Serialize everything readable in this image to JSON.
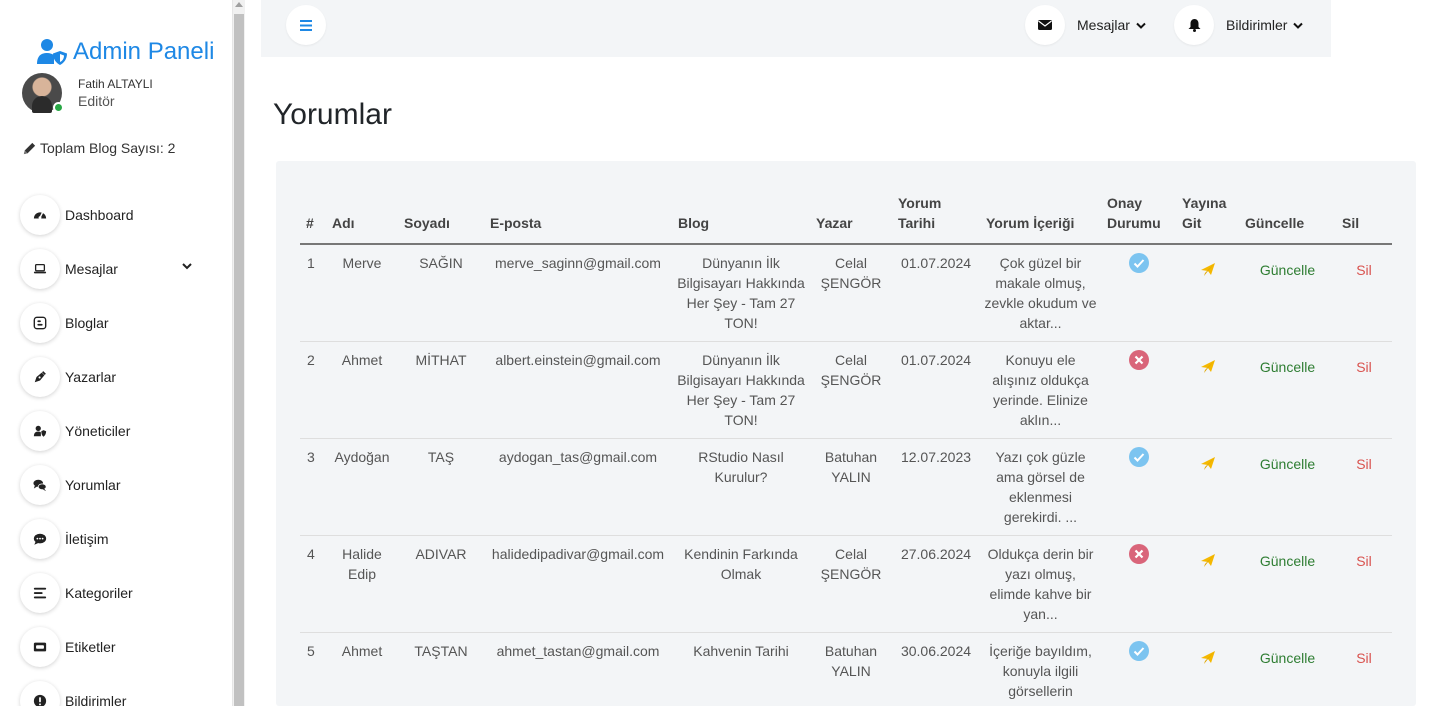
{
  "sidebar": {
    "brand": "Admin Paneli",
    "user_name": "Fatih ALTAYLI",
    "user_role": "Editör",
    "blog_count": "Toplam Blog Sayısı: 2",
    "items": [
      {
        "label": "Dashboard",
        "icon": "gauge-icon"
      },
      {
        "label": "Mesajlar",
        "icon": "laptop-icon"
      },
      {
        "label": "Bloglar",
        "icon": "blogger-icon"
      },
      {
        "label": "Yazarlar",
        "icon": "pen-icon"
      },
      {
        "label": "Yöneticiler",
        "icon": "user-shield-icon"
      },
      {
        "label": "Yorumlar",
        "icon": "comments-icon"
      },
      {
        "label": "İletişim",
        "icon": "comment-dots-icon"
      },
      {
        "label": "Kategoriler",
        "icon": "list-icon"
      },
      {
        "label": "Etiketler",
        "icon": "tag-icon"
      },
      {
        "label": "Bildirimler",
        "icon": "exclamation-icon"
      }
    ]
  },
  "topbar": {
    "messages": "Mesajlar",
    "notifications": "Bildirimler"
  },
  "page": {
    "title": "Yorumlar"
  },
  "table": {
    "headers": {
      "num": "#",
      "name": "Adı",
      "surname": "Soyadı",
      "email": "E-posta",
      "blog": "Blog",
      "author": "Yazar",
      "date": "Yorum Tarihi",
      "content": "Yorum İçeriği",
      "status": "Onay Durumu",
      "goto": "Yayına Git",
      "update": "Güncelle",
      "delete": "Sil"
    },
    "rows": [
      {
        "num": "1",
        "name": "Merve",
        "surname": "SAĞIN",
        "email": "merve_saginn@gmail.com",
        "blog": "Dünyanın İlk Bilgisayarı Hakkında Her Şey - Tam 27 TON!",
        "author": "Celal ŞENGÖR",
        "date": "01.07.2024",
        "content": "Çok güzel bir makale olmuş, zevkle okudum ve aktar...",
        "approved": true,
        "update": "Güncelle",
        "delete": "Sil"
      },
      {
        "num": "2",
        "name": "Ahmet",
        "surname": "MİTHAT",
        "email": "albert.einstein@gmail.com",
        "blog": "Dünyanın İlk Bilgisayarı Hakkında Her Şey - Tam 27 TON!",
        "author": "Celal ŞENGÖR",
        "date": "01.07.2024",
        "content": "Konuyu ele alışınız oldukça yerinde. Elinize aklın...",
        "approved": false,
        "update": "Güncelle",
        "delete": "Sil"
      },
      {
        "num": "3",
        "name": "Aydoğan",
        "surname": "TAŞ",
        "email": "aydogan_tas@gmail.com",
        "blog": "RStudio Nasıl Kurulur?",
        "author": "Batuhan YALIN",
        "date": "12.07.2023",
        "content": "Yazı çok güzle ama görsel de eklenmesi gerekirdi. ...",
        "approved": true,
        "update": "Güncelle",
        "delete": "Sil"
      },
      {
        "num": "4",
        "name": "Halide Edip",
        "surname": "ADIVAR",
        "email": "halidedipadivar@gmail.com",
        "blog": "Kendinin Farkında Olmak",
        "author": "Celal ŞENGÖR",
        "date": "27.06.2024",
        "content": "Oldukça derin bir yazı olmuş, elimde kahve bir yan...",
        "approved": false,
        "update": "Güncelle",
        "delete": "Sil"
      },
      {
        "num": "5",
        "name": "Ahmet",
        "surname": "TAŞTAN",
        "email": "ahmet_tastan@gmail.com",
        "blog": "Kahvenin Tarihi",
        "author": "Batuhan YALIN",
        "date": "30.06.2024",
        "content": "İçeriğe bayıldım, konuyla ilgili görsellerin",
        "approved": true,
        "update": "Güncelle",
        "delete": "Sil"
      }
    ]
  },
  "colors": {
    "brand": "#1e88e5",
    "approved": "#7cc4f0",
    "rejected": "#d9657a",
    "send": "#f5b800",
    "update": "#2e7d32",
    "delete": "#d9534f"
  }
}
